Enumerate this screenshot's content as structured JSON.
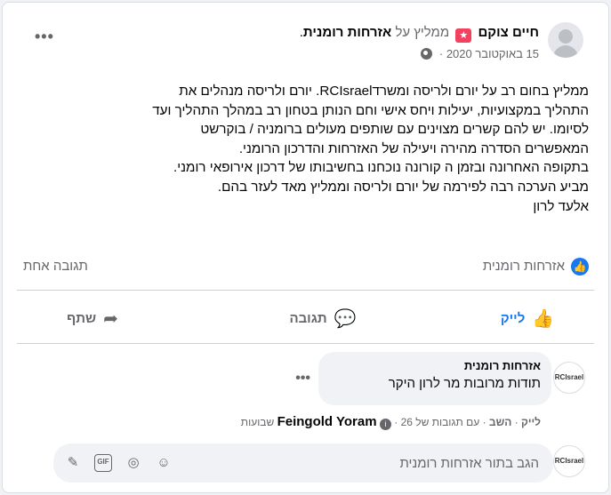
{
  "post": {
    "author": "חיים צוקם",
    "recommends_text": "ממליץ על",
    "page_name": "אזרחות רומנית",
    "page_suffix": ".",
    "date": "15 באוקטובר 2020",
    "date_separator": "·",
    "text_lines": [
      "ממליץ בחום רב על יורם ולריסה ומשרדRCIsrael. יורם ולריסה מנהלים את",
      "התהליך במקצועיות, יעילות ויחס אישי וחם הנותן בטחון רב במהלך התהליך ועד",
      "לסיומו. יש להם קשרים מצוינים  עם שותפים מעולים ברומניה / בוקרשט",
      "המאפשרים הסדרה מהירה ויעילה של האזרחות והדרכון הרומני.",
      "בתקופה האחרונה ובזמן ה קורונה נוכחנו בחשיבותו של דרכון אירופאי רומני.",
      "מביע הערכה רבה לפירמה של יורם ולריסה וממליץ מאד לעזר בהם.",
      "אלעד לרון"
    ]
  },
  "reactions": {
    "reactor_name": "אזרחות רומנית",
    "comment_count": "תגובה אחת"
  },
  "actions": {
    "like": "לייק",
    "comment": "תגובה",
    "share": "שתף"
  },
  "comment": {
    "author": "אזרחות רומנית",
    "text": "תודות מרובות מר לרון היקר",
    "avatar_text": "RCIsrael",
    "like": "לייק",
    "reply": "השב",
    "replied_by_prefix": "עם תגובות של",
    "replied_by": "Feingold Yoram",
    "age": "26 שבועות"
  },
  "reply_box": {
    "placeholder": "הגב בתור אזרחות רומנית"
  },
  "colors": {
    "brand_blue": "#1877f2",
    "recommend_red": "#f3425f",
    "muted_text": "#65676b"
  },
  "icons": [
    "globe-icon",
    "more-icon",
    "like-icon",
    "comment-icon",
    "share-icon",
    "info-icon",
    "emoji-icon",
    "camera-icon",
    "gif-icon",
    "sticker-icon"
  ]
}
